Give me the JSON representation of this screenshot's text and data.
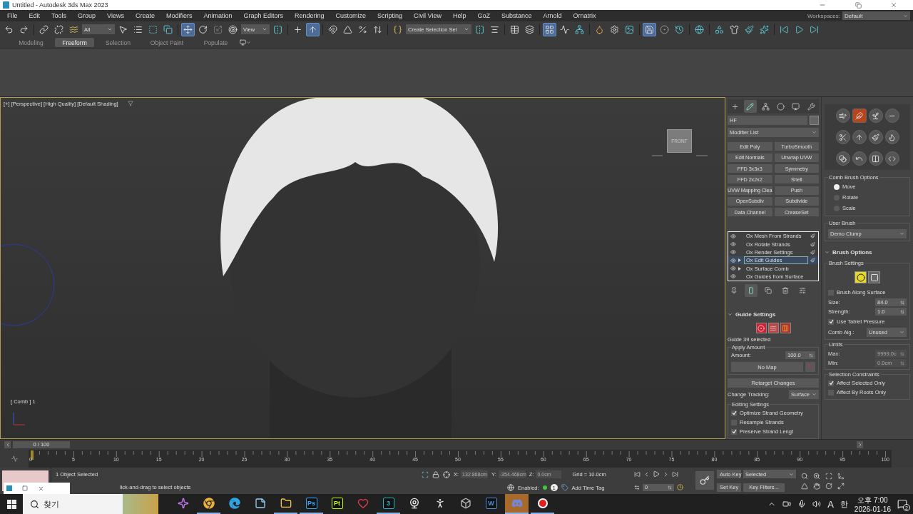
{
  "window": {
    "title": "Untitled - Autodesk 3ds Max 2023"
  },
  "menu": [
    "File",
    "Edit",
    "Tools",
    "Group",
    "Views",
    "Create",
    "Modifiers",
    "Animation",
    "Graph Editors",
    "Rendering",
    "Customize",
    "Scripting",
    "Civil View",
    "Help",
    "GoZ",
    "Substance",
    "Arnold",
    "Ornatrix"
  ],
  "workspaces": {
    "label": "Workspaces:",
    "value": "Default"
  },
  "toolbar": [
    {
      "kind": "undo",
      "selected": false
    },
    {
      "kind": "redo",
      "selected": false
    },
    {
      "kind": "separator"
    },
    {
      "kind": "link",
      "selected": false
    },
    {
      "kind": "unlink",
      "selected": false
    },
    {
      "kind": "bind",
      "selected": false
    },
    {
      "kind": "dropdown",
      "value": "All",
      "wide": false
    },
    {
      "kind": "select",
      "selected": false
    },
    {
      "kind": "select-name",
      "selected": false
    },
    {
      "kind": "region",
      "selected": false
    },
    {
      "kind": "crossing",
      "selected": false
    },
    {
      "kind": "separator"
    },
    {
      "kind": "move",
      "selected": true
    },
    {
      "kind": "rotate",
      "selected": false
    },
    {
      "kind": "scale",
      "selected": false
    },
    {
      "kind": "place",
      "selected": false
    },
    {
      "kind": "dropdown",
      "value": "View",
      "wide": false
    },
    {
      "kind": "pivot",
      "selected": false
    },
    {
      "kind": "separator"
    },
    {
      "kind": "manipulate",
      "selected": false
    },
    {
      "kind": "keyboard",
      "selected": true
    },
    {
      "kind": "separator"
    },
    {
      "kind": "snap",
      "selected": false
    },
    {
      "kind": "angle",
      "selected": false
    },
    {
      "kind": "percent",
      "selected": false
    },
    {
      "kind": "spinner",
      "selected": false
    },
    {
      "kind": "separator"
    },
    {
      "kind": "named",
      "selected": false
    },
    {
      "kind": "dropdown",
      "value": "Create Selection Sel",
      "wide": true
    },
    {
      "kind": "mirror",
      "selected": false
    },
    {
      "kind": "align",
      "selected": false
    },
    {
      "kind": "separator"
    },
    {
      "kind": "scene",
      "selected": false
    },
    {
      "kind": "layers",
      "selected": false
    },
    {
      "kind": "separator"
    },
    {
      "kind": "ribbon",
      "selected": true
    },
    {
      "kind": "curves",
      "selected": false
    },
    {
      "kind": "schematic",
      "selected": false
    },
    {
      "kind": "separator"
    },
    {
      "kind": "material",
      "selected": false
    },
    {
      "kind": "render-setup",
      "selected": false
    },
    {
      "kind": "frame",
      "selected": false
    },
    {
      "kind": "separator"
    },
    {
      "kind": "save",
      "selected": true
    },
    {
      "kind": "nine",
      "selected": false
    },
    {
      "kind": "history",
      "selected": false
    },
    {
      "kind": "separator"
    },
    {
      "kind": "globe",
      "selected": false
    },
    {
      "kind": "separator"
    },
    {
      "kind": "shapes",
      "selected": false
    },
    {
      "kind": "shirt",
      "selected": false
    },
    {
      "kind": "brush",
      "selected": false
    },
    {
      "kind": "sparkle",
      "selected": false
    },
    {
      "kind": "separator"
    },
    {
      "kind": "prev",
      "selected": false
    },
    {
      "kind": "play",
      "selected": false
    },
    {
      "kind": "next",
      "selected": false
    }
  ],
  "ribbon_tabs": [
    {
      "label": "Modeling",
      "selected": false
    },
    {
      "label": "Freeform",
      "selected": true
    },
    {
      "label": "Selection",
      "selected": false
    },
    {
      "label": "Object Paint",
      "selected": false
    },
    {
      "label": "Populate",
      "selected": false
    }
  ],
  "viewport": {
    "label": "[+] [Perspective] [High Quality] [Default Shading]",
    "mode": "[ Comb ] 1",
    "viewcube": "FRONT"
  },
  "command_panel": {
    "tabs": [
      {
        "kind": "create",
        "selected": false
      },
      {
        "kind": "modify",
        "selected": true
      },
      {
        "kind": "hierarchy",
        "selected": false
      },
      {
        "kind": "motion",
        "selected": false
      },
      {
        "kind": "display",
        "selected": false
      },
      {
        "kind": "utilities",
        "selected": false
      }
    ],
    "object_name": "HF",
    "modifier_list": "Modifier List",
    "modifier_buttons": [
      "Edit Poly",
      "TurboSmooth",
      "Edit Normals",
      "Unwrap UVW",
      "FFD 3x3x3",
      "Symmetry",
      "FFD 2x2x2",
      "Shell",
      "UVW Mapping Clea",
      "Push",
      "OpenSubdiv",
      "Subdivide",
      "Data Channel",
      "CreaseSet"
    ],
    "stack": [
      {
        "label": "Ox Mesh From Strands",
        "expandable": false,
        "editable": true,
        "selected": false
      },
      {
        "label": "Ox Rotate Strands",
        "expandable": false,
        "editable": true,
        "selected": false
      },
      {
        "label": "Ox Render Settings",
        "expandable": false,
        "editable": true,
        "selected": false
      },
      {
        "label": "Ox Edit Guides",
        "expandable": true,
        "editable": true,
        "selected": true
      },
      {
        "label": "Ox Surface Comb",
        "expandable": true,
        "editable": false,
        "selected": false
      },
      {
        "label": "Ox Guides from Surface",
        "expandable": false,
        "editable": false,
        "selected": false
      }
    ],
    "stack_tools": [
      {
        "kind": "pin",
        "selected": false
      },
      {
        "kind": "show-result",
        "selected": true
      },
      {
        "kind": "unique",
        "selected": false
      },
      {
        "kind": "remove",
        "selected": false
      },
      {
        "kind": "configure",
        "selected": false
      }
    ],
    "guide_settings": {
      "title": "Guide Settings",
      "modes": [
        {
          "kind": "target"
        },
        {
          "kind": "strands"
        },
        {
          "kind": "comb"
        }
      ],
      "info": "Guide 39 selected",
      "apply_group": "Apply Amount",
      "amount_label": "Amount:",
      "amount": "100.0",
      "map_button": "No Map",
      "retarget": "Retarget Changes",
      "tracking_label": "Change Tracking:",
      "tracking": "Surface",
      "editing_group": "Editing Settings",
      "options": [
        {
          "label": "Optimize Strand Geometry",
          "checked": true
        },
        {
          "label": "Resample Strands",
          "checked": false
        },
        {
          "label": "Preserve Strand Lengt",
          "checked": true
        }
      ]
    },
    "brush_panel": {
      "brushes": [
        {
          "kind": "comb",
          "selected": false
        },
        {
          "kind": "pull",
          "selected": true
        },
        {
          "kind": "grow",
          "selected": false
        },
        {
          "kind": "cut",
          "selected": false
        },
        {
          "kind": "scissors",
          "selected": false
        },
        {
          "kind": "lift",
          "selected": false
        },
        {
          "kind": "paint",
          "selected": false
        },
        {
          "kind": "clump",
          "selected": false
        },
        {
          "kind": "smooth",
          "selected": false
        },
        {
          "kind": "curl",
          "selected": false
        },
        {
          "kind": "split",
          "selected": false
        },
        {
          "kind": "script",
          "selected": false
        }
      ],
      "comb_group": "Comb Brush Options",
      "comb_modes": [
        {
          "label": "Move",
          "selected": true
        },
        {
          "label": "Rotate",
          "selected": false
        },
        {
          "label": "Scale",
          "selected": false
        }
      ],
      "user_group": "User Brush",
      "user_brush": "Demo Clump",
      "title": "Brush Options",
      "settings_group": "Brush Settings",
      "shapes": [
        {
          "kind": "circle",
          "selected": true
        },
        {
          "kind": "square",
          "selected": false
        }
      ],
      "along_surface": {
        "label": "Brush Along Surface",
        "checked": false
      },
      "fields": [
        {
          "label": "Size:",
          "value": "84.0"
        },
        {
          "label": "Strength:",
          "value": "1.0"
        }
      ],
      "tablet": {
        "label": "Use Tablet Pressure",
        "checked": true
      },
      "algorithm": {
        "label": "Comb Alg.:",
        "value": "Unused"
      },
      "limits_group": "Limits",
      "limits": [
        {
          "label": "Max:",
          "value": "9999.0c",
          "disabled": true
        },
        {
          "label": "Min:",
          "value": "0.0cm",
          "disabled": true
        }
      ],
      "constraints_group": "Selection Constraints",
      "constraints": [
        {
          "label": "Affect Selected Only",
          "checked": true
        },
        {
          "label": "Affect By Roots Only",
          "checked": false
        }
      ]
    }
  },
  "time_slider": {
    "label": "0 / 100",
    "level": 0
  },
  "trackbar": {
    "ticks": [
      "0",
      "5",
      "10",
      "15",
      "20",
      "25",
      "30",
      "35",
      "40",
      "45",
      "50",
      "55",
      "60",
      "65",
      "70",
      "75",
      "80",
      "85",
      "90",
      "95",
      "100"
    ]
  },
  "status": {
    "selection": "1 Object Selected",
    "prompt": "lick-and-drag to select objects",
    "coords": [
      {
        "label": "X:",
        "value": "132.868cm"
      },
      {
        "label": "Y:",
        "value": "-354.468cm"
      },
      {
        "label": "Z:",
        "value": "0.0cm"
      }
    ],
    "grid": "Grid = 10.0cm",
    "enabled_label": "Enabled:",
    "enabled": true,
    "badge": "1",
    "time_tag": "Add Time Tag",
    "frame": "0",
    "auto_key": "Auto Key",
    "set_key": "Set Key",
    "key_mode": "Selected",
    "key_filters": "Key Filters..."
  },
  "taskbar": {
    "search": "찾기",
    "apps": [
      {
        "kind": "copilot",
        "running": false,
        "selected": false
      },
      {
        "kind": "chrome",
        "running": true,
        "selected": false
      },
      {
        "kind": "edge",
        "running": false,
        "selected": false
      },
      {
        "kind": "notepad",
        "running": false,
        "selected": false
      },
      {
        "kind": "explorer",
        "running": true,
        "selected": false
      },
      {
        "kind": "tile",
        "label": "Ps",
        "color": "#31a8ff",
        "running": true,
        "selected": false
      },
      {
        "kind": "tile",
        "label": "Pt",
        "color": "#c1ff00",
        "running": false,
        "selected": false
      },
      {
        "kind": "heart",
        "running": false,
        "selected": false
      },
      {
        "kind": "tile",
        "label": "3",
        "color": "#2fb5c7",
        "running": true,
        "selected": false
      },
      {
        "kind": "webcam",
        "running": false,
        "selected": false
      },
      {
        "kind": "figure",
        "running": false,
        "selected": false
      },
      {
        "kind": "cube",
        "running": false,
        "selected": false
      },
      {
        "kind": "tile",
        "label": "W",
        "color": "#4a8fe0",
        "running": false,
        "selected": false
      },
      {
        "kind": "discord",
        "running": true,
        "selected": true
      },
      {
        "kind": "record",
        "running": true,
        "selected": false
      }
    ],
    "ime": "A",
    "lang": "한",
    "time": "오후 7:00",
    "date": "2026-01-16",
    "notifications": "2"
  }
}
